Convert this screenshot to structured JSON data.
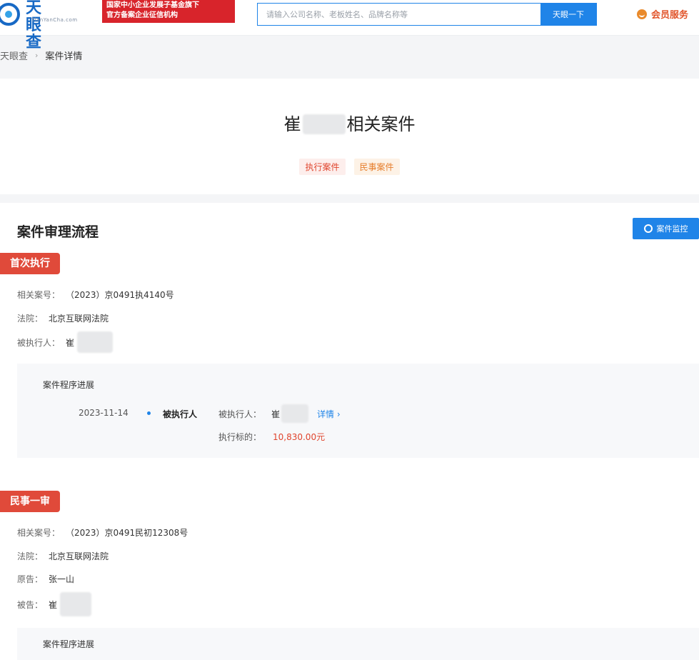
{
  "header": {
    "logo_text": "天眼查",
    "logo_sub": "TianYanCha.com",
    "promo_line1": "国家中小企业发展子基金旗下",
    "promo_line2": "官方备案企业征信机构",
    "search_placeholder": "请输入公司名称、老板姓名、品牌名称等",
    "search_button": "天眼一下",
    "vip_label": "会员服务"
  },
  "breadcrumb": {
    "home": "天眼查",
    "separator": "›",
    "current": "案件详情"
  },
  "title": {
    "prefix": "崔",
    "suffix": "相关案件",
    "tabs": [
      "执行案件",
      "民事案件"
    ]
  },
  "main": {
    "section_title": "案件审理流程",
    "monitor_button": "案件监控",
    "cases": [
      {
        "tag": "首次执行",
        "case_no_label": "相关案号：",
        "case_no": "（2023）京0491执4140号",
        "court_label": "法院：",
        "court": "北京互联网法院",
        "party_label": "被执行人：",
        "party": "崔",
        "progress_title": "案件程序进展",
        "progress": {
          "date": "2023-11-14",
          "role": "被执行人",
          "party_label": "被执行人：",
          "party": "崔",
          "detail": "详情 ›",
          "amount_label": "执行标的：",
          "amount": "10,830.00元"
        }
      },
      {
        "tag": "民事一审",
        "case_no_label": "相关案号：",
        "case_no": "（2023）京0491民初12308号",
        "court_label": "法院：",
        "court": "北京互联网法院",
        "plaintiff_label": "原告：",
        "plaintiff": "张一山",
        "defendant_label": "被告：",
        "defendant": "崔",
        "progress_title": "案件程序进展"
      }
    ]
  },
  "colors": {
    "brand_blue": "#1f84e8",
    "tag_red": "#e04a3a",
    "amount_red": "#e0442d"
  }
}
